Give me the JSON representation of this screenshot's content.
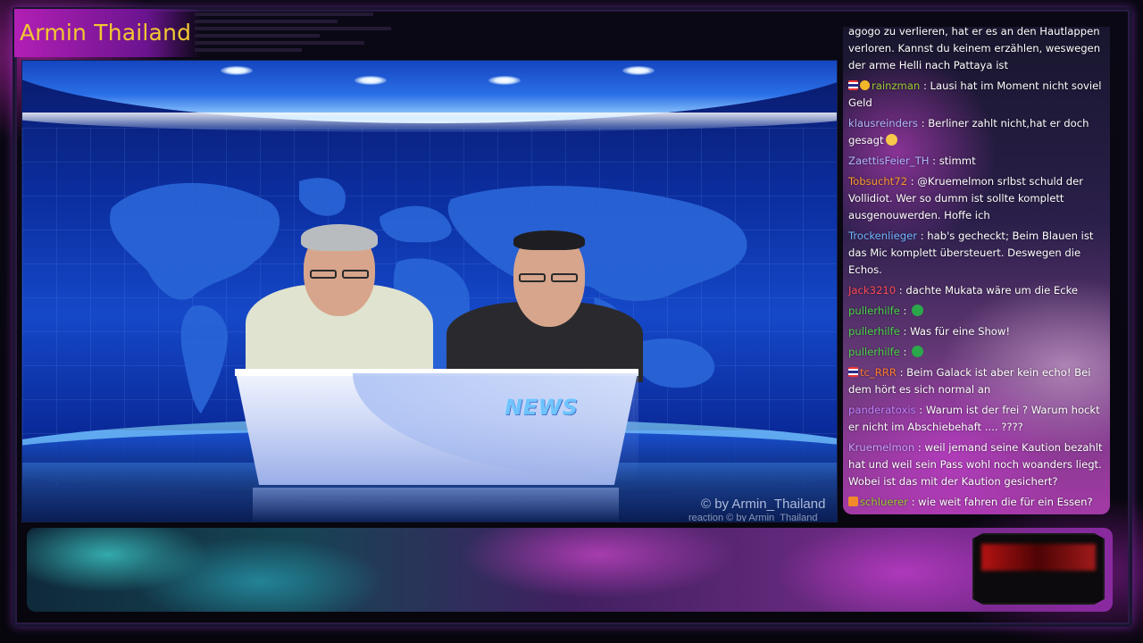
{
  "channel": {
    "title": "Armin Thailand"
  },
  "video": {
    "desk_logo": "NEWS",
    "watermark": "© by Armin_Thailand",
    "watermark_sub": "reaction  © by Armin_Thailand"
  },
  "chat": {
    "messages": [
      {
        "user": "",
        "text": "agogo zu verlieren, hat er es an den Hautlappen verloren. Kannst du keinem erzählen, weswegen der arme Helli nach Pattaya ist",
        "color": "#ffffff",
        "badges": []
      },
      {
        "user": "rainzman",
        "text": " : Lausi hat im Moment nicht soviel Geld",
        "color": "#9acd32",
        "badges": [
          "flag-th",
          "coin"
        ]
      },
      {
        "user": "klausreinders",
        "text": " : Berliner zahlt nicht,hat er doch gesagt",
        "color": "#b0b8ff",
        "badges": [],
        "emote": "laugh"
      },
      {
        "user": "ZaettisFeier_TH",
        "text": " : stimmt",
        "color": "#b0b8ff",
        "badges": []
      },
      {
        "user": "Tobsucht72",
        "text": " : @Kruemelmon srlbst schuld der Vollidiot. Wer so dumm ist sollte komplett ausgenouwerden. Hoffe ich",
        "color": "#ff9d2e",
        "badges": []
      },
      {
        "user": "Trockenlieger",
        "text": " : hab's gecheckt; Beim Blauen ist das Mic komplett übersteuert. Deswegen die Echos.",
        "color": "#6fb6ff",
        "badges": []
      },
      {
        "user": "Jack3210",
        "text": " : dachte Mukata wäre um die Ecke",
        "color": "#ff4a5a",
        "badges": []
      },
      {
        "user": "pullerhilfe",
        "text": " : ",
        "color": "#4ad44a",
        "badges": [],
        "emote": "check"
      },
      {
        "user": "pullerhilfe",
        "text": " : Was für eine Show!",
        "color": "#4ad44a",
        "badges": []
      },
      {
        "user": "pullerhilfe",
        "text": " : ",
        "color": "#4ad44a",
        "badges": [],
        "emote": "check"
      },
      {
        "user": "tc_RRR",
        "text": " : Beim Galack ist aber kein echo! Bei dem hört es sich normal an",
        "color": "#ff7a2e",
        "badges": [
          "flag-th"
        ]
      },
      {
        "user": "panderatoxis",
        "text": " : Warum ist der frei ? Warum hockt er nicht im Abschiebehaft .... ????",
        "color": "#c080ff",
        "badges": []
      },
      {
        "user": "Kruemelmon",
        "text": " : weil jemand seine Kaution bezahlt hat und weil sein Pass wohl noch woanders liegt. Wobei ist das mit der Kaution gesichert?",
        "color": "#c8a0ff",
        "badges": []
      },
      {
        "user": "schluerer",
        "text": " : wie weit fahren die für ein Essen?",
        "color": "#9acd32",
        "badges": [
          "crown"
        ]
      }
    ]
  },
  "colors": {
    "title_gold": "#f2c832",
    "overlay_magenta": "#b21fb4",
    "studio_blue": "#1548c8"
  }
}
